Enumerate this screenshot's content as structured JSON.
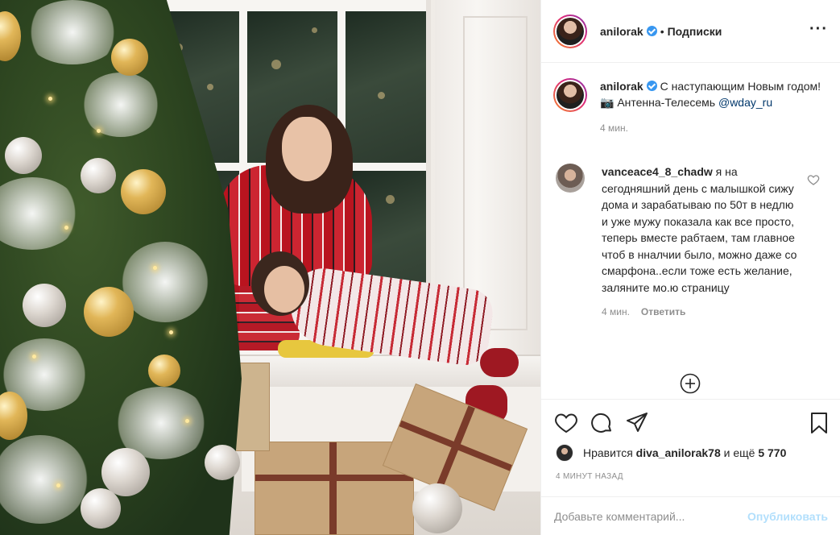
{
  "post": {
    "author": "anilorak",
    "follow_label": "Подписки",
    "dot": "•"
  },
  "caption": {
    "username": "anilorak",
    "text_line1": "С наступающим Новым годом!",
    "photo_credit_prefix": "📷 Антенна-Телесемь ",
    "photo_credit_mention": "@wday_ru",
    "time": "4 мин."
  },
  "comment": {
    "username": "vanceace4_8_chadw",
    "text": "я на сегодняшний день с малышкой сижу дома и зарабатываю по 50т в недлю и уже мужу показала как все просто, теперь вместе рабтаем, там главное чтоб в ннaлчии было, можно даже со смарфона..если тоже есть желание, заляните мо.ю страницу",
    "time": "4 мин.",
    "reply_label": "Ответить"
  },
  "likes": {
    "prefix": "Нравится ",
    "user": "diva_anilorak78",
    "middle": " и ещё ",
    "count": "5 770"
  },
  "time_ago": "4 минут назад",
  "add_comment": {
    "placeholder": "Добавьте комментарий...",
    "publish_label": "Опубликовать"
  },
  "icons": {
    "more": "more-options-icon",
    "like": "heart-icon",
    "comment": "comment-icon",
    "share": "share-icon",
    "save": "bookmark-icon",
    "load_more": "plus-circle-icon"
  },
  "colors": {
    "link": "#00376b",
    "muted": "#8e8e8e",
    "verified": "#3897f0",
    "publish_disabled": "#b2dffc"
  }
}
